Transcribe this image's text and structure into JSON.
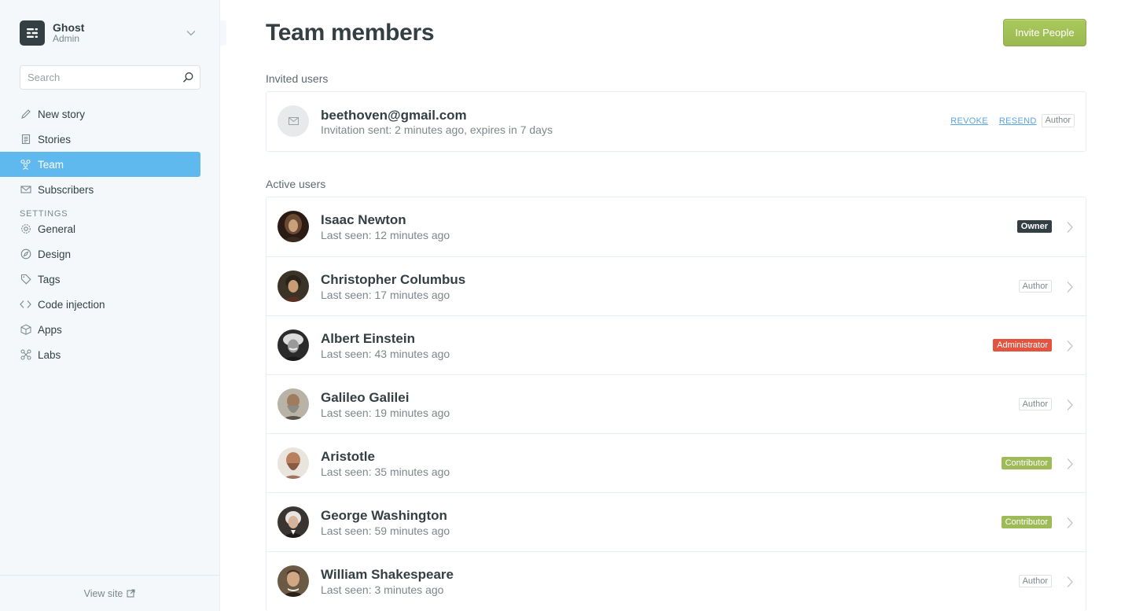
{
  "sidebar": {
    "brand": {
      "name": "Ghost",
      "role": "Admin"
    },
    "search": {
      "placeholder": "Search"
    },
    "nav": [
      {
        "label": "New story",
        "icon": "pencil-icon"
      },
      {
        "label": "Stories",
        "icon": "document-icon"
      },
      {
        "label": "Team",
        "icon": "team-icon",
        "active": true
      },
      {
        "label": "Subscribers",
        "icon": "mail-icon"
      }
    ],
    "settings_heading": "SETTINGS",
    "settings": [
      {
        "label": "General",
        "icon": "gear-icon"
      },
      {
        "label": "Design",
        "icon": "compass-icon"
      },
      {
        "label": "Tags",
        "icon": "tag-icon"
      },
      {
        "label": "Code injection",
        "icon": "code-icon"
      },
      {
        "label": "Apps",
        "icon": "box-icon"
      },
      {
        "label": "Labs",
        "icon": "labs-icon"
      }
    ],
    "footer": {
      "label": "View site"
    }
  },
  "main": {
    "title": "Team members",
    "invite_button": "Invite People",
    "invited_label": "Invited users",
    "invited": {
      "email": "beethoven@gmail.com",
      "meta": "Invitation sent: 2 minutes ago, expires in 7 days",
      "revoke": "REVOKE",
      "resend": "RESEND",
      "role": "Author"
    },
    "active_label": "Active users",
    "users": [
      {
        "name": "Isaac Newton",
        "meta": "Last seen: 12 minutes ago",
        "role": "Owner"
      },
      {
        "name": "Christopher Columbus",
        "meta": "Last seen: 17 minutes ago",
        "role": "Author"
      },
      {
        "name": "Albert Einstein",
        "meta": "Last seen: 43 minutes ago",
        "role": "Administrator"
      },
      {
        "name": "Galileo Galilei",
        "meta": "Last seen: 19 minutes ago",
        "role": "Author"
      },
      {
        "name": "Aristotle",
        "meta": "Last seen: 35 minutes ago",
        "role": "Contributor"
      },
      {
        "name": "George Washington",
        "meta": "Last seen: 59 minutes ago",
        "role": "Contributor"
      },
      {
        "name": "William Shakespeare",
        "meta": "Last seen: 3 minutes ago",
        "role": "Author"
      }
    ]
  },
  "colors": {
    "accent": "#5fb9ef",
    "green": "#9fbb58",
    "red": "#e25440",
    "dark": "#343f44"
  }
}
